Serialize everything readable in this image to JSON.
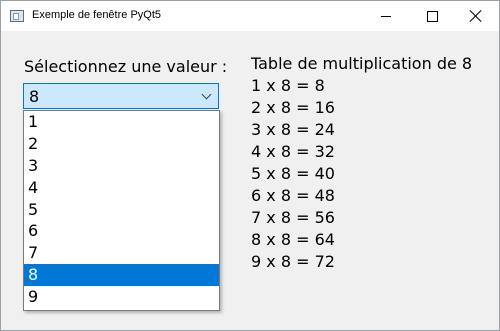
{
  "window": {
    "title": "Exemple de fenêtre PyQt5",
    "icons": {
      "app": "window-icon",
      "minimize": "minimize-icon",
      "maximize": "maximize-icon",
      "close": "close-icon"
    }
  },
  "form": {
    "select_label": "Sélectionnez une valeur :",
    "combobox": {
      "selected_value": "8",
      "options": [
        "1",
        "2",
        "3",
        "4",
        "5",
        "6",
        "7",
        "8",
        "9"
      ]
    }
  },
  "table": {
    "title": "Table de multiplication de 8",
    "rows": [
      "1 x 8 = 8",
      "2 x 8 = 16",
      "3 x 8 = 24",
      "4 x 8 = 32",
      "5 x 8 = 40",
      "6 x 8 = 48",
      "7 x 8 = 56",
      "8 x 8 = 64",
      "9 x 8 = 72"
    ]
  },
  "colors": {
    "window_bg": "#f0f0f0",
    "selection": "#0078d7",
    "combobox_bg": "#cce8ff"
  }
}
